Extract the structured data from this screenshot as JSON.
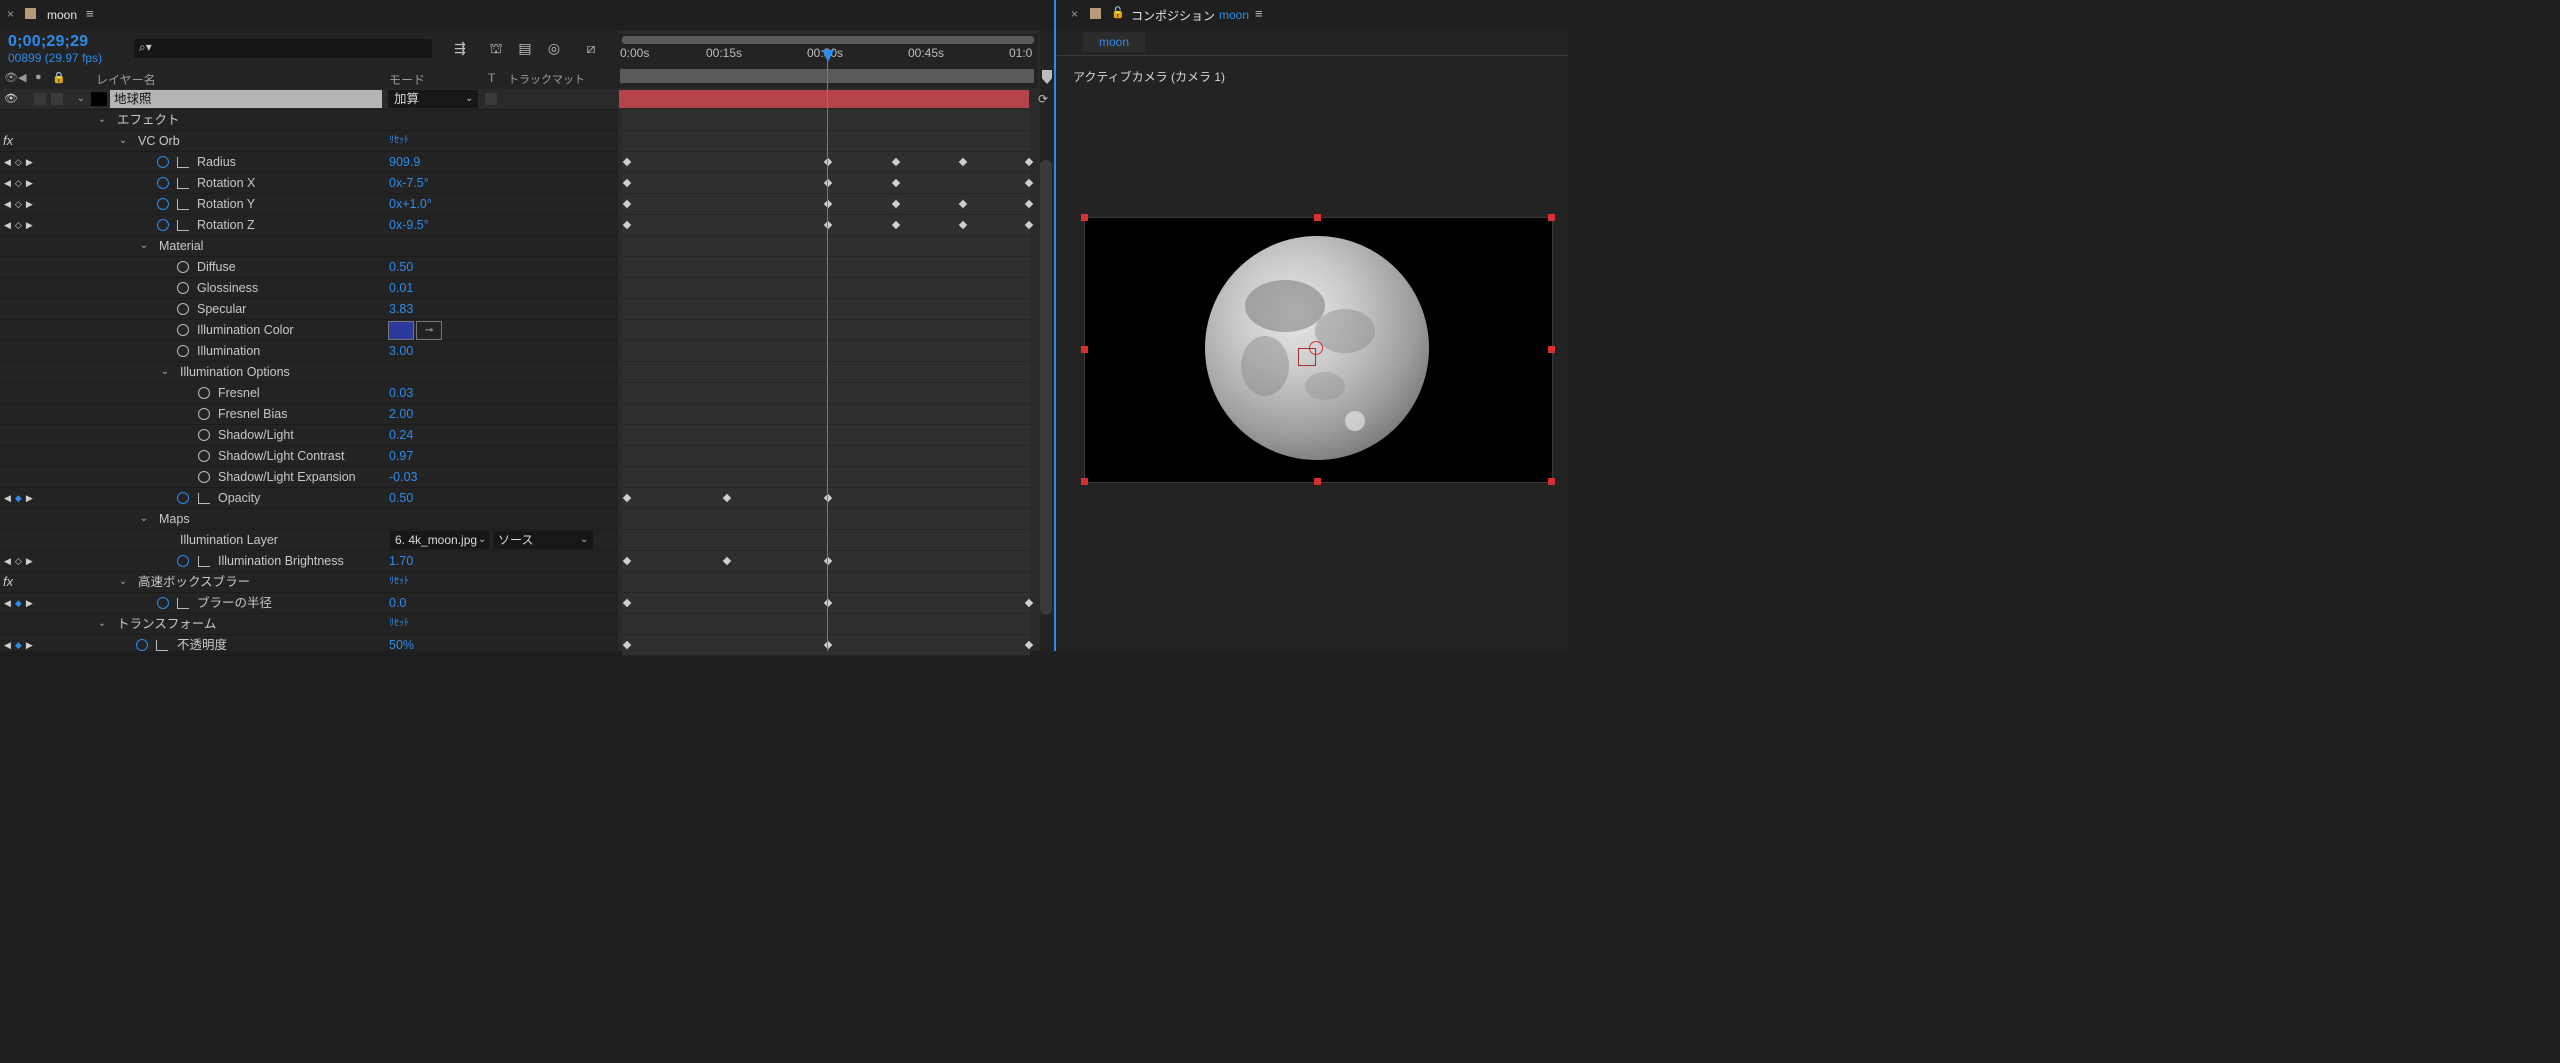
{
  "timeline_tab": {
    "title": "moon"
  },
  "comp_tab": {
    "title": "コンポジション",
    "comp_name": "moon",
    "sub_tab": "moon",
    "camera": "アクティブカメラ (カメラ 1)"
  },
  "timecode": "0;00;29;29",
  "frames": "00899 (29.97 fps)",
  "columns": {
    "layer_name": "レイヤー名",
    "mode": "モード",
    "t": "T",
    "track_matte": "トラックマット"
  },
  "ruler": {
    "t0": "0:00s",
    "t15": "00:15s",
    "t30": "00:30s",
    "t45": "00:45s",
    "t60": "01:0"
  },
  "layer": {
    "name": "地球照",
    "mode": "加算"
  },
  "rows": {
    "effect": "エフェクト",
    "vcorb": "VC Orb",
    "reset": "ﾘｾｯﾄ",
    "radius": {
      "label": "Radius",
      "value": "909.9"
    },
    "rotx": {
      "label": "Rotation X",
      "value": "0x-7.5°"
    },
    "roty": {
      "label": "Rotation Y",
      "value": "0x+1.0°"
    },
    "rotz": {
      "label": "Rotation Z",
      "value": "0x-9.5°"
    },
    "material": "Material",
    "diffuse": {
      "label": "Diffuse",
      "value": "0.50"
    },
    "gloss": {
      "label": "Glossiness",
      "value": "0.01"
    },
    "specular": {
      "label": "Specular",
      "value": "3.83"
    },
    "illumcolor": {
      "label": "Illumination Color",
      "color": "#2b3a9c"
    },
    "illum": {
      "label": "Illumination",
      "value": "3.00"
    },
    "illumopts": "Illumination Options",
    "fresnel": {
      "label": "Fresnel",
      "value": "0.03"
    },
    "fresnelbias": {
      "label": "Fresnel Bias",
      "value": "2.00"
    },
    "shadow": {
      "label": "Shadow/Light",
      "value": "0.24"
    },
    "shadowcon": {
      "label": "Shadow/Light Contrast",
      "value": "0.97"
    },
    "shadowexp": {
      "label": "Shadow/Light Expansion",
      "value": "-0.03"
    },
    "opacity": {
      "label": "Opacity",
      "value": "0.50"
    },
    "maps": "Maps",
    "illumlayer": {
      "label": "Illumination Layer",
      "layer": "6. 4k_moon.jpg",
      "source": "ソース"
    },
    "illumbright": {
      "label": "Illumination Brightness",
      "value": "1.70"
    },
    "boxblur": "高速ボックスブラー",
    "blurradius": {
      "label": "ブラーの半径",
      "value": "0.0"
    },
    "transform": "トランスフォーム",
    "opacity_jp": {
      "label": "不透明度",
      "value": "50%"
    }
  }
}
